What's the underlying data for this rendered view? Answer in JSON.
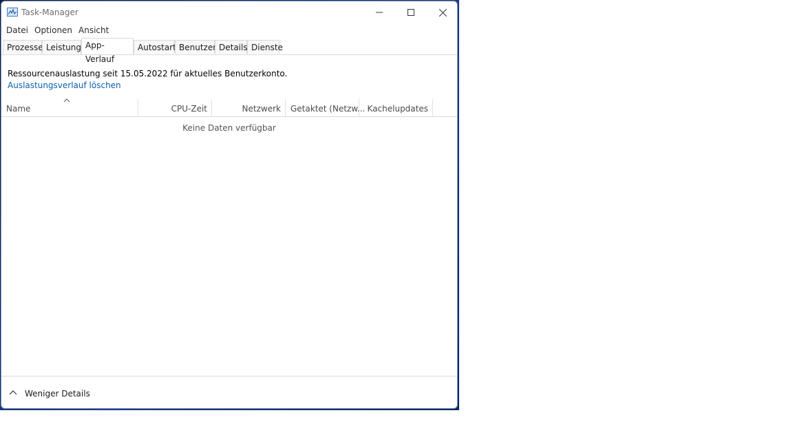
{
  "window": {
    "title": "Task-Manager"
  },
  "menu": [
    "Datei",
    "Optionen",
    "Ansicht"
  ],
  "tabs": [
    "Prozesse",
    "Leistung",
    "App-Verlauf",
    "Autostart",
    "Benutzer",
    "Details",
    "Dienste"
  ],
  "active_tab": "App-Verlauf",
  "content": {
    "info_text": "Ressourcenauslastung seit 15.05.2022 für aktuelles Benutzerkonto.",
    "clear_link": "Auslastungsverlauf löschen",
    "columns": [
      "Name",
      "CPU-Zeit",
      "Netzwerk",
      "Getaktet (Netzw...",
      "Kachelupdates"
    ],
    "sorted_column": "Name",
    "empty_message": "Keine Daten verfügbar"
  },
  "footer": {
    "label": "Weniger Details"
  },
  "colors": {
    "link": "#0a5fad",
    "title_gray": "#6d6d6d",
    "desktop": "#1b3f8f"
  }
}
